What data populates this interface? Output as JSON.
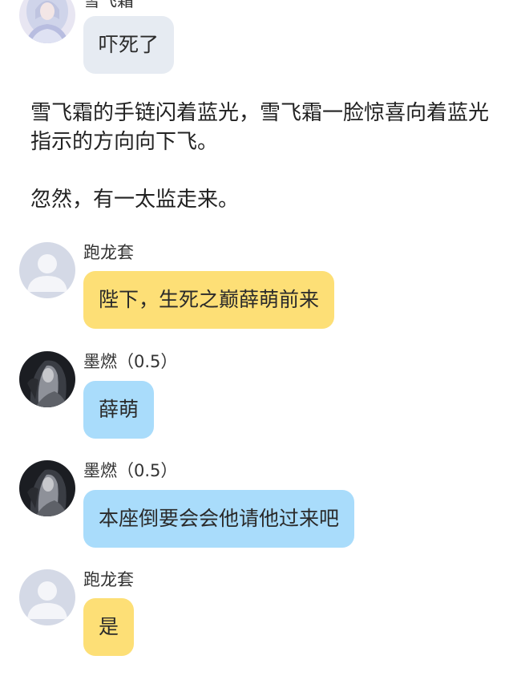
{
  "messages": [
    {
      "sender": "雪飞霜",
      "text": "吓死了",
      "style": "gray"
    },
    {
      "sender": "跑龙套",
      "text": "陛下，生死之巅薛萌前来",
      "style": "yellow"
    },
    {
      "sender": "墨燃（0.5）",
      "text": "薛萌",
      "style": "blue"
    },
    {
      "sender": "墨燃（0.5）",
      "text": "本座倒要会会他请他过来吧",
      "style": "blue"
    },
    {
      "sender": "跑龙套",
      "text": "是",
      "style": "yellow"
    }
  ],
  "narration": [
    "雪飞霜的手链闪着蓝光，雪飞霜一脸惊喜向着蓝光指示的方向向下飞。",
    "忽然，有一太监走来。"
  ],
  "colors": {
    "bubble_gray": "#e6ebf2",
    "bubble_yellow": "#fddf76",
    "bubble_blue": "#a9dcfb",
    "default_avatar_bg": "#d4d9e6"
  }
}
